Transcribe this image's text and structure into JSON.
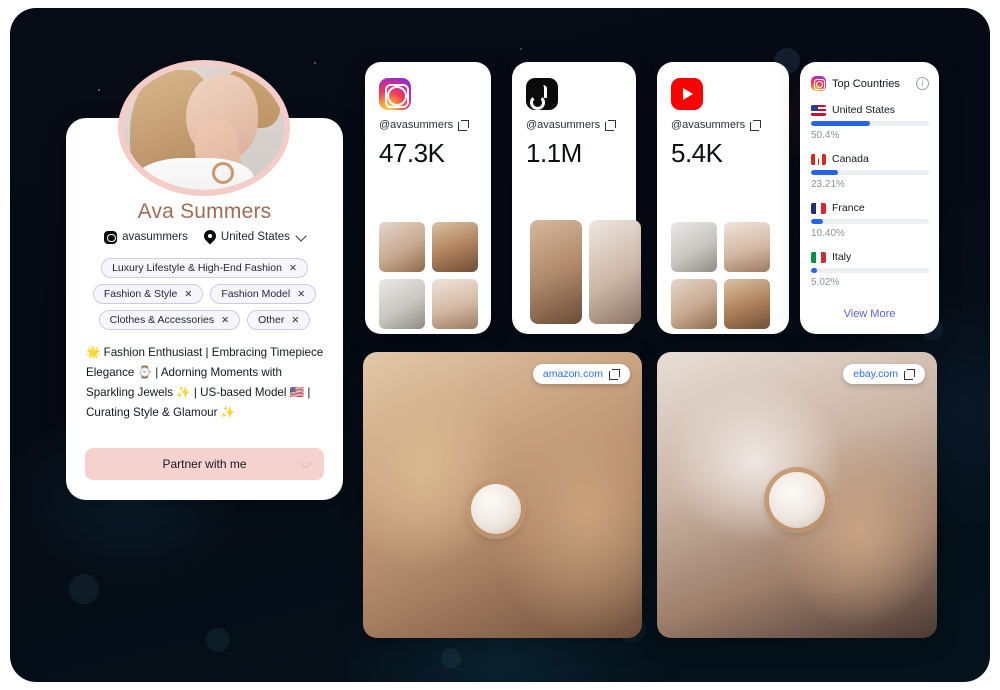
{
  "profile": {
    "name": "Ava Summers",
    "handle": "avasummers",
    "location": "United States",
    "tags": [
      {
        "label": "Luxury Lifestyle & High-End Fashion",
        "remove": "✕"
      },
      {
        "label": "Fashion & Style",
        "remove": "✕"
      },
      {
        "label": "Fashion Model",
        "remove": "✕"
      },
      {
        "label": "Clothes & Accessories",
        "remove": "✕"
      },
      {
        "label": "Other",
        "remove": "✕"
      }
    ],
    "bio": "🌟 Fashion Enthusiast | Embracing Timepiece Elegance ⌚ | Adorning Moments with Sparkling Jewels ✨ | US-based Model 🇺🇸 | Curating Style & Glamour ✨",
    "cta_label": "Partner with me",
    "instagram_icon": "instagram-glyph-icon",
    "location_icon": "map-pin-icon",
    "chevron_icon": "chevron-down-icon"
  },
  "socials": [
    {
      "platform": "instagram",
      "icon": "instagram-icon",
      "handle": "@avasummers",
      "link_icon": "external-link-icon",
      "followers": "47.3K",
      "thumb_layout": "grid",
      "thumbs": [
        "post-thumbnail-1",
        "post-thumbnail-2",
        "post-thumbnail-3",
        "post-thumbnail-4"
      ]
    },
    {
      "platform": "tiktok",
      "icon": "tiktok-icon",
      "handle": "@avasummers",
      "link_icon": "external-link-icon",
      "followers": "1.1M",
      "thumb_layout": "tall",
      "thumbs": [
        "video-thumbnail-1",
        "video-thumbnail-2"
      ]
    },
    {
      "platform": "youtube",
      "icon": "youtube-icon",
      "handle": "@avasummers",
      "link_icon": "external-link-icon",
      "followers": "5.4K",
      "thumb_layout": "grid",
      "thumbs": [
        "video-thumbnail-1",
        "video-thumbnail-2",
        "video-thumbnail-3",
        "video-thumbnail-4"
      ]
    }
  ],
  "top_countries": {
    "title": "Top Countries",
    "source_icon": "instagram-icon",
    "info_icon": "info-icon",
    "info_glyph": "i",
    "items": [
      {
        "name": "United States",
        "percent": "50.4%",
        "value": 50.4,
        "flag": "flag-us"
      },
      {
        "name": "Canada",
        "percent": "23.21%",
        "value": 23.21,
        "flag": "flag-ca"
      },
      {
        "name": "France",
        "percent": "10.40%",
        "value": 10.4,
        "flag": "flag-fr"
      },
      {
        "name": "Italy",
        "percent": "5.02%",
        "value": 5.02,
        "flag": "flag-it"
      }
    ],
    "view_more_label": "View More"
  },
  "products": [
    {
      "badge": "amazon.com",
      "link_icon": "external-link-icon",
      "image": "watch-product-photo-1"
    },
    {
      "badge": "ebay.com",
      "link_icon": "external-link-icon",
      "image": "watch-product-photo-2"
    }
  ],
  "colors": {
    "accent_pink": "#f6d2cf",
    "name_brown": "#9f6b57",
    "bar_blue": "#2563eb",
    "link_blue": "#5b5fe3",
    "badge_blue": "#2f6df6",
    "backdrop_dark": "#070b16"
  }
}
